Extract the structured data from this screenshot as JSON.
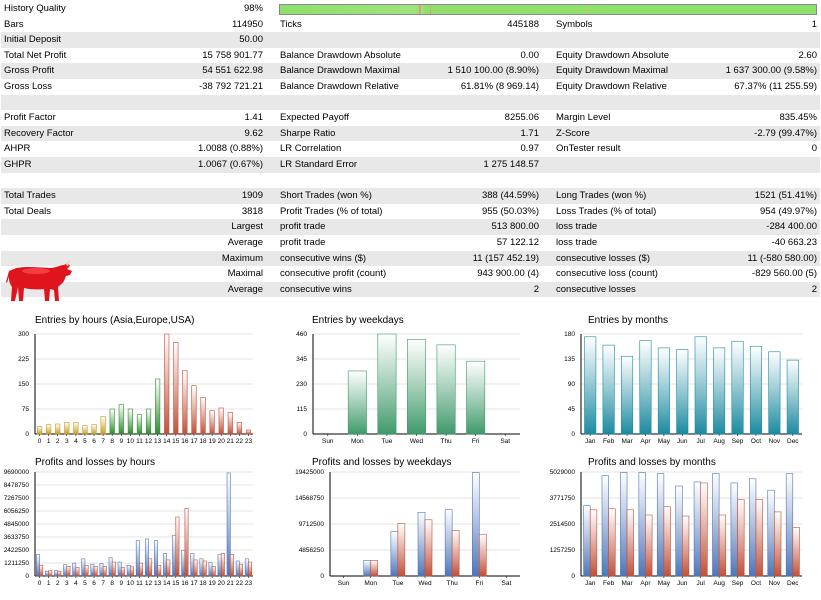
{
  "stats": {
    "history_quality": {
      "label": "History Quality",
      "value": "98%"
    },
    "rows": [
      {
        "alt": false,
        "c": [
          [
            "Bars",
            "114950"
          ],
          [
            "Ticks",
            "445188"
          ],
          [
            "Symbols",
            "1"
          ]
        ]
      },
      {
        "alt": true,
        "c": [
          [
            "Initial Deposit",
            "50.00"
          ],
          [
            "",
            ""
          ],
          [
            "",
            ""
          ]
        ]
      },
      {
        "alt": false,
        "c": [
          [
            "Total Net Profit",
            "15 758 901.77"
          ],
          [
            "Balance Drawdown Absolute",
            "0.00"
          ],
          [
            "Equity Drawdown Absolute",
            "2.60"
          ]
        ]
      },
      {
        "alt": true,
        "c": [
          [
            "Gross Profit",
            "54 551 622.98"
          ],
          [
            "Balance Drawdown Maximal",
            "1 510 100.00 (8.90%)"
          ],
          [
            "Equity Drawdown Maximal",
            "1 637 300.00 (9.58%)"
          ]
        ]
      },
      {
        "alt": false,
        "c": [
          [
            "Gross Loss",
            "-38 792 721.21"
          ],
          [
            "Balance Drawdown Relative",
            "61.81% (8 969.14)"
          ],
          [
            "Equity Drawdown Relative",
            "67.37% (11 255.59)"
          ]
        ]
      },
      {
        "alt": true,
        "c": [
          [
            "",
            ""
          ],
          [
            "",
            ""
          ],
          [
            "",
            ""
          ]
        ]
      },
      {
        "alt": false,
        "c": [
          [
            "Profit Factor",
            "1.41"
          ],
          [
            "Expected Payoff",
            "8255.06"
          ],
          [
            "Margin Level",
            "835.45%"
          ]
        ]
      },
      {
        "alt": true,
        "c": [
          [
            "Recovery Factor",
            "9.62"
          ],
          [
            "Sharpe Ratio",
            "1.71"
          ],
          [
            "Z-Score",
            "-2.79 (99.47%)"
          ]
        ]
      },
      {
        "alt": false,
        "c": [
          [
            "AHPR",
            "1.0088 (0.88%)"
          ],
          [
            "LR Correlation",
            "0.97"
          ],
          [
            "OnTester result",
            "0"
          ]
        ]
      },
      {
        "alt": true,
        "c": [
          [
            "GHPR",
            "1.0067 (0.67%)"
          ],
          [
            "LR Standard Error",
            "1 275 148.57"
          ],
          [
            "",
            ""
          ]
        ]
      },
      {
        "alt": false,
        "c": [
          [
            "",
            ""
          ],
          [
            "",
            ""
          ],
          [
            "",
            ""
          ]
        ]
      },
      {
        "alt": true,
        "c": [
          [
            "Total Trades",
            "1909"
          ],
          [
            "Short Trades (won %)",
            "388 (44.59%)"
          ],
          [
            "Long Trades (won %)",
            "1521 (51.41%)"
          ]
        ]
      },
      {
        "alt": false,
        "c": [
          [
            "Total Deals",
            "3818"
          ],
          [
            "Profit Trades (% of total)",
            "955 (50.03%)"
          ],
          [
            "Loss Trades (% of total)",
            "954 (49.97%)"
          ]
        ]
      },
      {
        "alt": true,
        "c": [
          [
            "Largest",
            ""
          ],
          [
            "profit trade",
            "513 800.00"
          ],
          [
            "loss trade",
            "-284 400.00"
          ]
        ],
        "rlabel": true
      },
      {
        "alt": false,
        "c": [
          [
            "Average",
            ""
          ],
          [
            "profit trade",
            "57 122.12"
          ],
          [
            "loss trade",
            "-40 663.23"
          ]
        ],
        "rlabel": true
      },
      {
        "alt": true,
        "c": [
          [
            "Maximum",
            ""
          ],
          [
            "consecutive wins ($)",
            "11 (157 452.19)"
          ],
          [
            "consecutive losses ($)",
            "11 (-580 580.00)"
          ]
        ],
        "rlabel": true
      },
      {
        "alt": false,
        "c": [
          [
            "Maximal",
            ""
          ],
          [
            "consecutive profit (count)",
            "943 900.00 (4)"
          ],
          [
            "consecutive loss (count)",
            "-829 560.00 (5)"
          ]
        ],
        "rlabel": true
      },
      {
        "alt": true,
        "c": [
          [
            "Average",
            ""
          ],
          [
            "consecutive wins",
            "2"
          ],
          [
            "consecutive losses",
            "2"
          ]
        ],
        "rlabel": true
      }
    ]
  },
  "logo_icon": "red-bull-icon",
  "colors": {
    "row_alt": "#e8e8e8",
    "quality_bar": "#8de06c",
    "profit": "#4e75b8",
    "loss": "#c0503a"
  },
  "chart_data": [
    {
      "type": "bar",
      "title": "Entries by hours (Asia,Europe,USA)",
      "categories": [
        "0",
        "1",
        "2",
        "3",
        "4",
        "5",
        "6",
        "7",
        "8",
        "9",
        "10",
        "11",
        "12",
        "13",
        "14",
        "15",
        "16",
        "17",
        "18",
        "19",
        "20",
        "21",
        "22",
        "23"
      ],
      "ylim": [
        0,
        300
      ],
      "yticks": [
        "0",
        "75",
        "150",
        "225",
        "300"
      ],
      "values": [
        22,
        28,
        30,
        35,
        35,
        25,
        28,
        52,
        75,
        88,
        75,
        58,
        75,
        165,
        300,
        275,
        190,
        145,
        110,
        70,
        78,
        65,
        35,
        12
      ],
      "bar_colors": [
        "#c89a1c",
        "#c89a1c",
        "#c89a1c",
        "#c89a1c",
        "#c89a1c",
        "#c89a1c",
        "#c89a1c",
        "#c89a1c",
        "#2e8b2e",
        "#2e8b2e",
        "#2e8b2e",
        "#2e8b2e",
        "#2e8b2e",
        "#2e8b2e",
        "#c0503a",
        "#c0503a",
        "#c0503a",
        "#c0503a",
        "#c0503a",
        "#c0503a",
        "#c0503a",
        "#c0503a",
        "#c0503a",
        "#c0503a"
      ]
    },
    {
      "type": "bar",
      "title": "Entries by weekdays",
      "categories": [
        "Sun",
        "Mon",
        "Tue",
        "Wed",
        "Thu",
        "Fri",
        "Sat"
      ],
      "ylim": [
        0,
        460
      ],
      "yticks": [
        "0",
        "115",
        "230",
        "345",
        "460"
      ],
      "values": [
        0,
        290,
        460,
        435,
        410,
        335,
        0
      ],
      "bar_colors": [
        "#3f9a6a"
      ]
    },
    {
      "type": "bar",
      "title": "Entries by months",
      "categories": [
        "Jan",
        "Feb",
        "Mar",
        "Apr",
        "May",
        "Jun",
        "Jul",
        "Aug",
        "Sep",
        "Oct",
        "Nov",
        "Dec"
      ],
      "ylim": [
        0,
        180
      ],
      "yticks": [
        "0",
        "45",
        "90",
        "135",
        "180"
      ],
      "values": [
        175,
        160,
        140,
        168,
        155,
        152,
        175,
        155,
        167,
        158,
        148,
        133
      ],
      "bar_colors": [
        "#1b8aa0"
      ]
    },
    {
      "type": "bar",
      "title": "Profits and losses by hours",
      "categories": [
        "0",
        "1",
        "2",
        "3",
        "4",
        "5",
        "6",
        "7",
        "8",
        "9",
        "10",
        "11",
        "12",
        "13",
        "14",
        "15",
        "16",
        "17",
        "18",
        "19",
        "20",
        "21",
        "22",
        "23"
      ],
      "ylim": [
        0,
        9690000
      ],
      "yticks": [
        "0",
        "1211250",
        "2422500",
        "3633750",
        "4845000",
        "6056250",
        "7267500",
        "8478750",
        "9690000"
      ],
      "series": [
        {
          "name": "",
          "values": [
            2000000,
            450000,
            500000,
            1050000,
            1200000,
            1600000,
            1100000,
            1150000,
            1700000,
            1300000,
            1000000,
            3300000,
            3450000,
            3300000,
            2100000,
            3800000,
            2400000,
            2100000,
            1600000,
            1250000,
            2000000,
            9600000,
            1400000,
            1600000
          ]
        },
        {
          "name": "",
          "values": [
            1000000,
            500000,
            450000,
            900000,
            800000,
            1000000,
            900000,
            900000,
            1300000,
            800000,
            850000,
            1200000,
            1600000,
            1000000,
            1500000,
            5500000,
            6300000,
            1500000,
            1400000,
            900000,
            2100000,
            2000000,
            1100000,
            1300000
          ]
        }
      ],
      "series_colors": [
        "#4e75b8",
        "#c0503a"
      ]
    },
    {
      "type": "bar",
      "title": "Profits and losses by weekdays",
      "categories": [
        "Sun",
        "Mon",
        "Tue",
        "Wed",
        "Thu",
        "Fri",
        "Sat"
      ],
      "ylim": [
        0,
        19425000
      ],
      "yticks": [
        "0",
        "4856250",
        "9712500",
        "14568750",
        "19425000"
      ],
      "series": [
        {
          "name": "",
          "values": [
            0,
            2900000,
            8300000,
            11900000,
            12400000,
            19300000,
            0
          ]
        },
        {
          "name": "",
          "values": [
            0,
            2900000,
            9800000,
            10500000,
            8500000,
            7800000,
            0
          ]
        }
      ],
      "series_colors": [
        "#4e75b8",
        "#c0503a"
      ]
    },
    {
      "type": "bar",
      "title": "Profits and losses by months",
      "categories": [
        "Jan",
        "Feb",
        "Mar",
        "Apr",
        "May",
        "Jun",
        "Jul",
        "Aug",
        "Sep",
        "Oct",
        "Nov",
        "Dec"
      ],
      "ylim": [
        0,
        5029000
      ],
      "yticks": [
        "0",
        "1257250",
        "2514500",
        "3771750",
        "5029000"
      ],
      "series": [
        {
          "name": "",
          "values": [
            3400000,
            4850000,
            5000000,
            5000000,
            4950000,
            4350000,
            4550000,
            4950000,
            4500000,
            4700000,
            4150000,
            4950000
          ]
        },
        {
          "name": "",
          "values": [
            3200000,
            3250000,
            3200000,
            2950000,
            3350000,
            2900000,
            4500000,
            2950000,
            3700000,
            3700000,
            3100000,
            2350000
          ]
        }
      ],
      "series_colors": [
        "#4e75b8",
        "#c0503a"
      ]
    }
  ]
}
